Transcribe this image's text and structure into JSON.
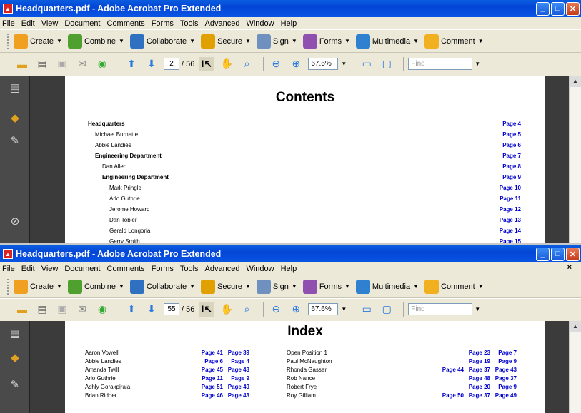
{
  "window1": {
    "title": "Headquarters.pdf - Adobe Acrobat Pro Extended",
    "current_page": "2",
    "total_pages": "/ 56",
    "zoom": "67.6%",
    "find_placeholder": "Find",
    "page_title": "Contents",
    "toc": [
      {
        "label": "Headquarters",
        "page": "Page 4",
        "level": 0,
        "bold": true
      },
      {
        "label": "Michael Burnette",
        "page": "Page 5",
        "level": 1,
        "bold": false
      },
      {
        "label": "Abbie Landies",
        "page": "Page 6",
        "level": 1,
        "bold": false
      },
      {
        "label": "Engineering Department",
        "page": "Page 7",
        "level": 1,
        "bold": true
      },
      {
        "label": "Dan Allen",
        "page": "Page 8",
        "level": 2,
        "bold": false
      },
      {
        "label": "Engineering Department",
        "page": "Page 9",
        "level": 2,
        "bold": true
      },
      {
        "label": "Mark Pringle",
        "page": "Page 10",
        "level": 3,
        "bold": false
      },
      {
        "label": "Arlo Guthrie",
        "page": "Page 11",
        "level": 3,
        "bold": false
      },
      {
        "label": "Jerome Howard",
        "page": "Page 12",
        "level": 3,
        "bold": false
      },
      {
        "label": "Dan Tobler",
        "page": "Page 13",
        "level": 3,
        "bold": false
      },
      {
        "label": "Gerald Longoria",
        "page": "Page 14",
        "level": 3,
        "bold": false
      },
      {
        "label": "Gerry Smith",
        "page": "Page 15",
        "level": 3,
        "bold": false
      }
    ]
  },
  "window2": {
    "title": "Headquarters.pdf - Adobe Acrobat Pro Extended",
    "current_page": "55",
    "total_pages": "/ 56",
    "zoom": "67.6%",
    "find_placeholder": "Find",
    "page_title": "Index",
    "index_left": [
      {
        "name": "Aaron Vowell",
        "pages": [
          "Page 41",
          "Page 39"
        ]
      },
      {
        "name": "Abbie Landies",
        "pages": [
          "Page 6",
          "Page 4"
        ]
      },
      {
        "name": "Amanda Twill",
        "pages": [
          "Page 45",
          "Page 43"
        ]
      },
      {
        "name": "Arlo Guthrie",
        "pages": [
          "Page 11",
          "Page 9"
        ]
      },
      {
        "name": "Ashly Gorakpiraia",
        "pages": [
          "Page 51",
          "Page 49"
        ]
      },
      {
        "name": "Brian Ridder",
        "pages": [
          "Page 46",
          "Page 43"
        ]
      }
    ],
    "index_right": [
      {
        "name": "Open Position 1",
        "pages": [
          "Page 23",
          "Page 7"
        ]
      },
      {
        "name": "Paul McNaughton",
        "pages": [
          "Page 19",
          "Page 9"
        ]
      },
      {
        "name": "Rhonda Gasser",
        "pages": [
          "Page 44",
          "Page 37",
          "Page 43"
        ]
      },
      {
        "name": "Rob Nance",
        "pages": [
          "Page 48",
          "Page 37"
        ]
      },
      {
        "name": "Robert Frye",
        "pages": [
          "Page 20",
          "Page 9"
        ]
      },
      {
        "name": "Roy Gilliam",
        "pages": [
          "Page 50",
          "Page 37",
          "Page 49"
        ]
      }
    ]
  },
  "menu": [
    "File",
    "Edit",
    "View",
    "Document",
    "Comments",
    "Forms",
    "Tools",
    "Advanced",
    "Window",
    "Help"
  ],
  "tasks": [
    {
      "label": "Create",
      "icon": "create-icon",
      "color": "#f0a020"
    },
    {
      "label": "Combine",
      "icon": "combine-icon",
      "color": "#50a030"
    },
    {
      "label": "Collaborate",
      "icon": "collaborate-icon",
      "color": "#3070c0"
    },
    {
      "label": "Secure",
      "icon": "lock-icon",
      "color": "#e0a000"
    },
    {
      "label": "Sign",
      "icon": "pen-icon",
      "color": "#7090c0"
    },
    {
      "label": "Forms",
      "icon": "forms-icon",
      "color": "#9050b0"
    },
    {
      "label": "Multimedia",
      "icon": "multimedia-icon",
      "color": "#3080d0"
    },
    {
      "label": "Comment",
      "icon": "comment-icon",
      "color": "#f0b020"
    }
  ],
  "icons": {
    "open": "folder-icon",
    "print": "print-icon",
    "save": "save-icon",
    "email": "email-icon",
    "prev": "arrow-up-icon",
    "next": "arrow-down-icon",
    "select": "select-tool-icon",
    "hand": "hand-icon",
    "zoom": "zoom-icon"
  }
}
